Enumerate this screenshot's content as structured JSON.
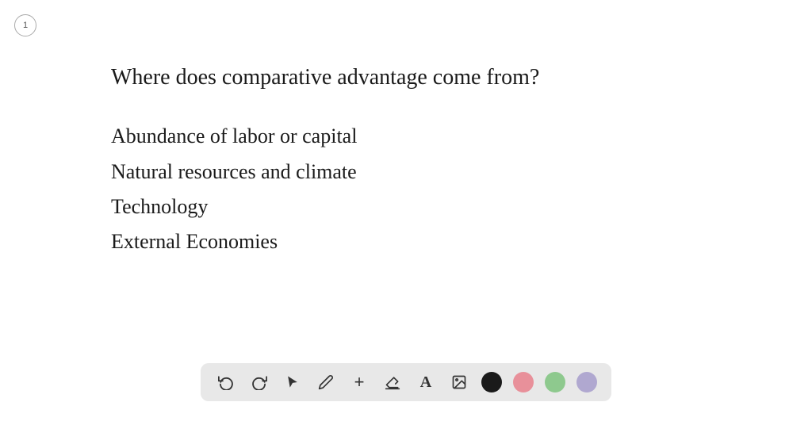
{
  "slide": {
    "number": "1",
    "title": "Where does comparative advantage come from?",
    "bullets": [
      "Abundance of labor or capital",
      "Natural resources and climate",
      "Technology",
      "External Economies"
    ]
  },
  "toolbar": {
    "undo_label": "↺",
    "redo_label": "↻",
    "select_label": "▶",
    "pencil_label": "✏",
    "plus_label": "+",
    "eraser_label": "✏",
    "text_label": "A",
    "image_label": "🖼",
    "colors": [
      {
        "name": "black",
        "hex": "#1a1a1a"
      },
      {
        "name": "pink",
        "hex": "#e8909a"
      },
      {
        "name": "green",
        "hex": "#8ec98e"
      },
      {
        "name": "lavender",
        "hex": "#b0a8d0"
      }
    ]
  }
}
